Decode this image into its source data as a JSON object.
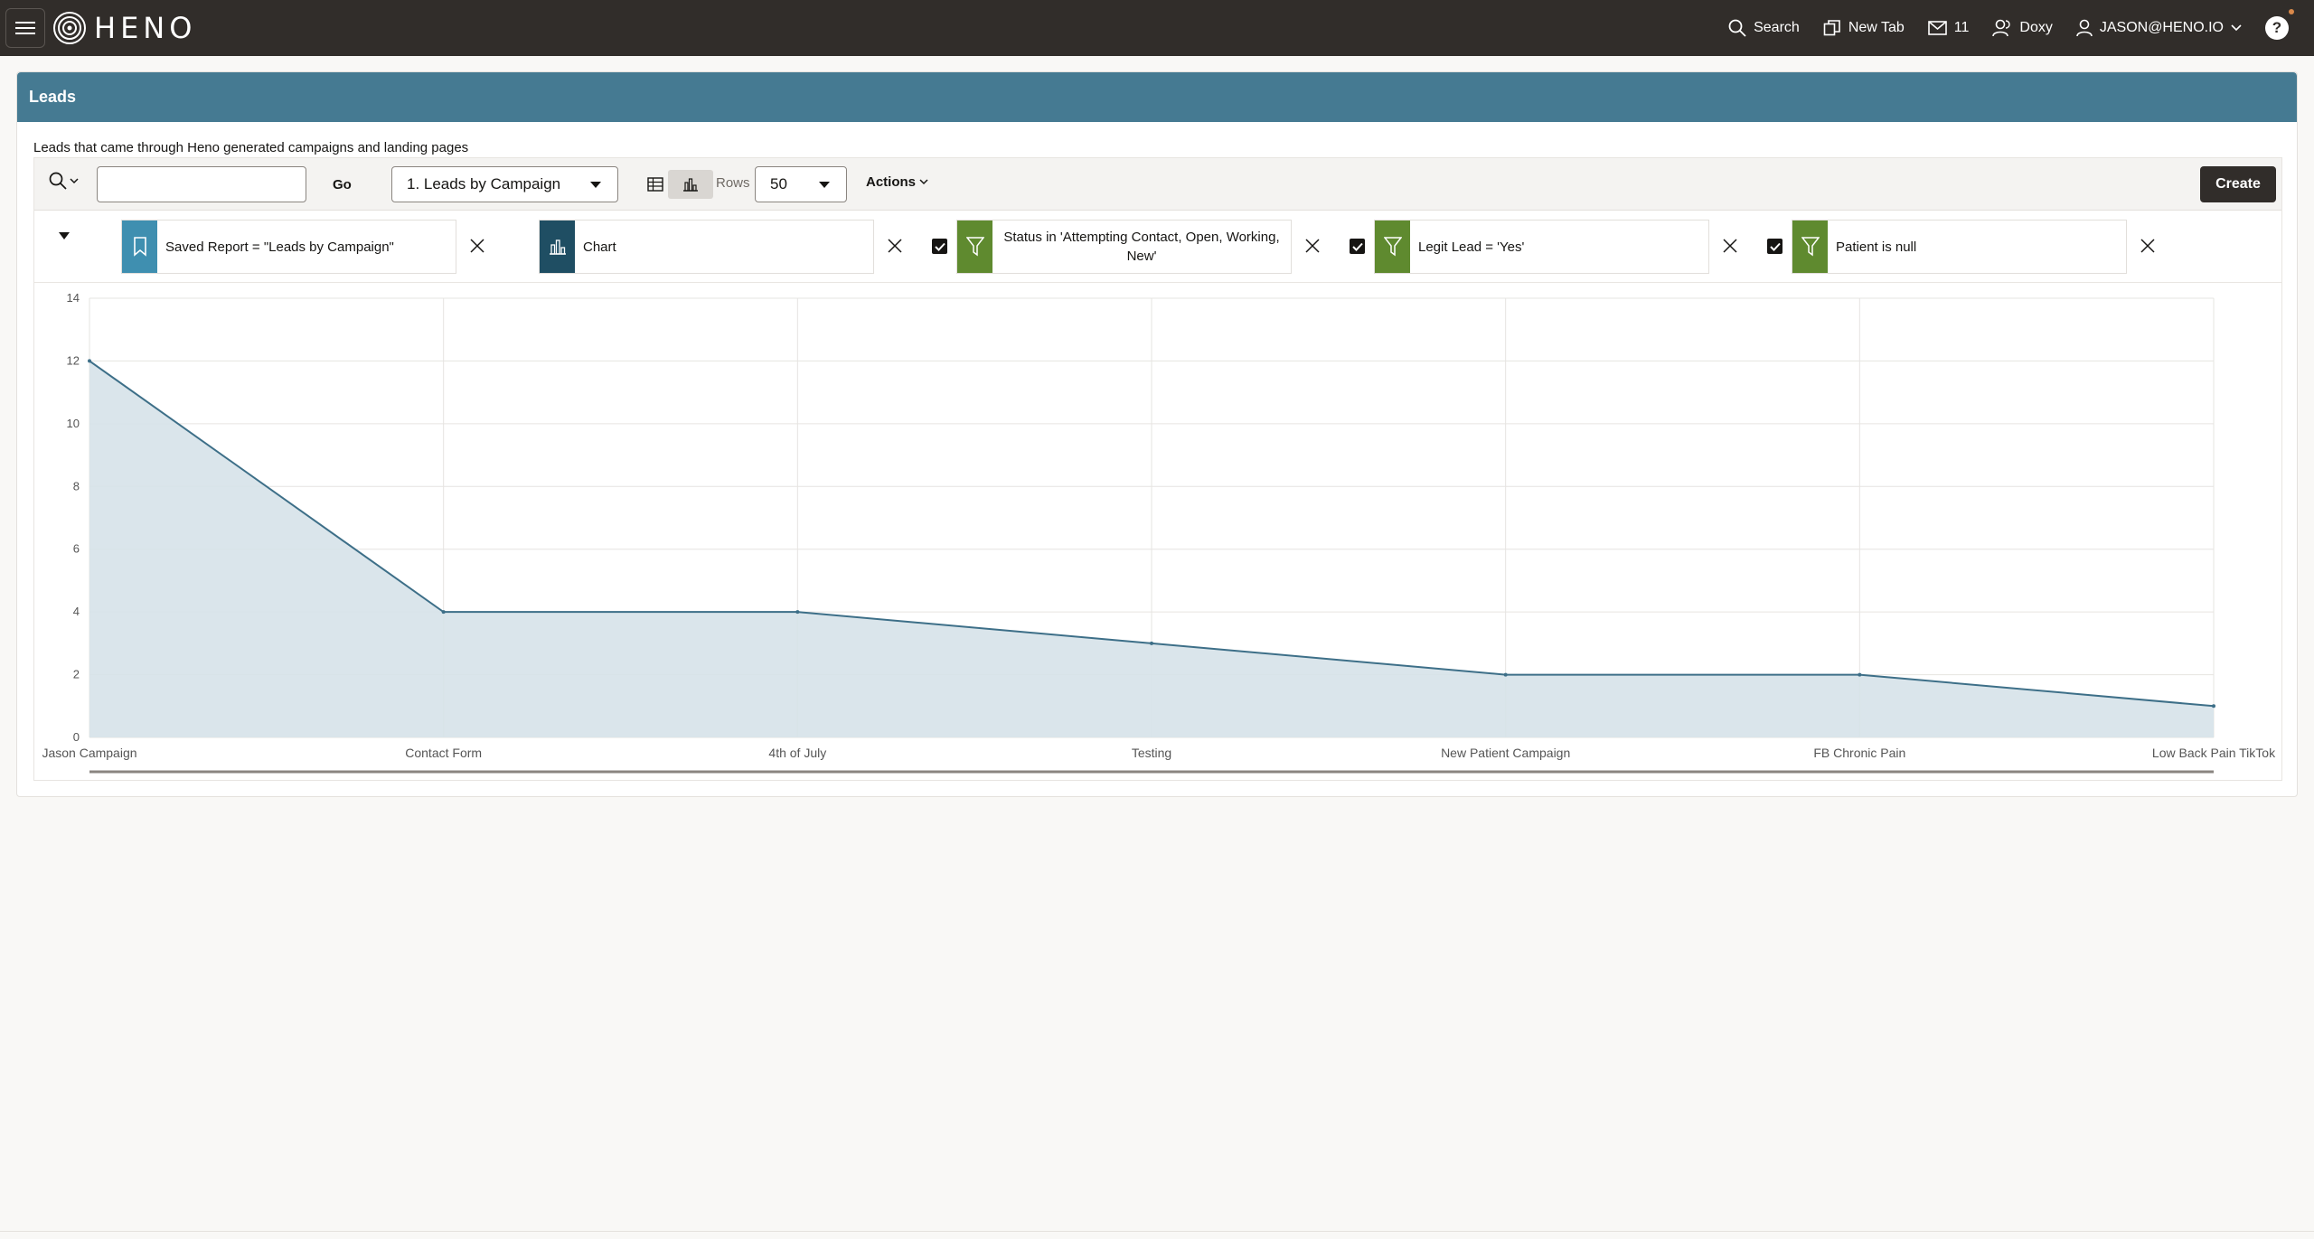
{
  "app": {
    "logo_text": "HENO",
    "menu_icon": "hamburger-icon",
    "colors": {
      "topbar": "#312d2a",
      "region_header": "#457a92",
      "chip_saved": "#3f8fb0",
      "chip_chart": "#1f4e63",
      "chip_filter": "#5f8a2f"
    }
  },
  "topnav": {
    "search_label": "Search",
    "new_tab_label": "New Tab",
    "mail_count": "11",
    "doxy_label": "Doxy",
    "user_label": "JASON@HENO.IO",
    "help_label": "?"
  },
  "region": {
    "title": "Leads",
    "description": "Leads that came through Heno generated campaigns and landing pages"
  },
  "toolbar": {
    "search_value": "",
    "go_label": "Go",
    "report_value": "1. Leads by Campaign",
    "rows_label": "Rows",
    "rows_value": "50",
    "actions_label": "Actions",
    "create_label": "Create"
  },
  "filters": [
    {
      "label": "Saved Report = \"Leads by Campaign\"",
      "icon": "bookmark-icon",
      "checked": null
    },
    {
      "label": "Chart",
      "icon": "bar-chart-icon",
      "checked": null
    },
    {
      "label": "Status in 'Attempting Contact, Open, Working, New'",
      "icon": "filter-icon",
      "checked": true
    },
    {
      "label": "Legit Lead = 'Yes'",
      "icon": "filter-icon",
      "checked": true
    },
    {
      "label": "Patient is null",
      "icon": "filter-icon",
      "checked": true
    }
  ],
  "chart_data": {
    "type": "area",
    "categories": [
      "Jason Campaign",
      "Contact Form",
      "4th of July",
      "Testing",
      "New Patient Campaign",
      "FB Chronic Pain",
      "Low Back Pain TikTok"
    ],
    "series": [
      {
        "values": [
          12,
          4,
          4,
          3,
          2,
          2,
          1
        ]
      }
    ],
    "yticks": [
      "0",
      "2",
      "4",
      "6",
      "8",
      "10",
      "12",
      "14"
    ],
    "ylim": [
      0,
      14
    ],
    "grid": true,
    "legend": "none",
    "colors": {
      "line": "#3d6f88",
      "fill": "#d6e2e9",
      "grid": "#e6e4e1"
    }
  }
}
